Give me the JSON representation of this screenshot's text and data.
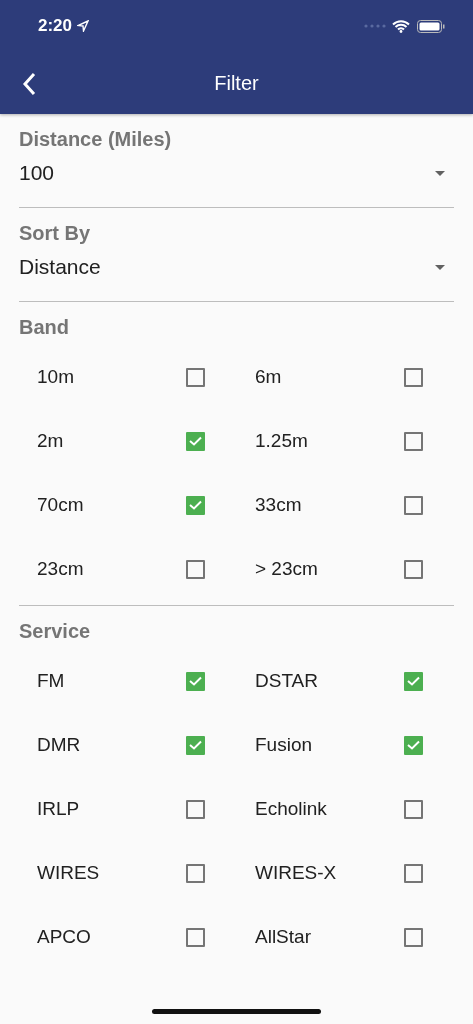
{
  "status_bar": {
    "time": "2:20"
  },
  "header": {
    "title": "Filter"
  },
  "dropdowns": [
    {
      "label": "Distance (Miles)",
      "value": "100"
    },
    {
      "label": "Sort By",
      "value": "Distance"
    }
  ],
  "groups": [
    {
      "label": "Band",
      "options": [
        {
          "label": "10m",
          "checked": false
        },
        {
          "label": "6m",
          "checked": false
        },
        {
          "label": "2m",
          "checked": true
        },
        {
          "label": "1.25m",
          "checked": false
        },
        {
          "label": "70cm",
          "checked": true
        },
        {
          "label": "33cm",
          "checked": false
        },
        {
          "label": "23cm",
          "checked": false
        },
        {
          "label": "> 23cm",
          "checked": false
        }
      ]
    },
    {
      "label": "Service",
      "options": [
        {
          "label": "FM",
          "checked": true
        },
        {
          "label": "DSTAR",
          "checked": true
        },
        {
          "label": "DMR",
          "checked": true
        },
        {
          "label": "Fusion",
          "checked": true
        },
        {
          "label": "IRLP",
          "checked": false
        },
        {
          "label": "Echolink",
          "checked": false
        },
        {
          "label": "WIRES",
          "checked": false
        },
        {
          "label": "WIRES-X",
          "checked": false
        },
        {
          "label": "APCO",
          "checked": false
        },
        {
          "label": "AllStar",
          "checked": false
        }
      ]
    }
  ]
}
